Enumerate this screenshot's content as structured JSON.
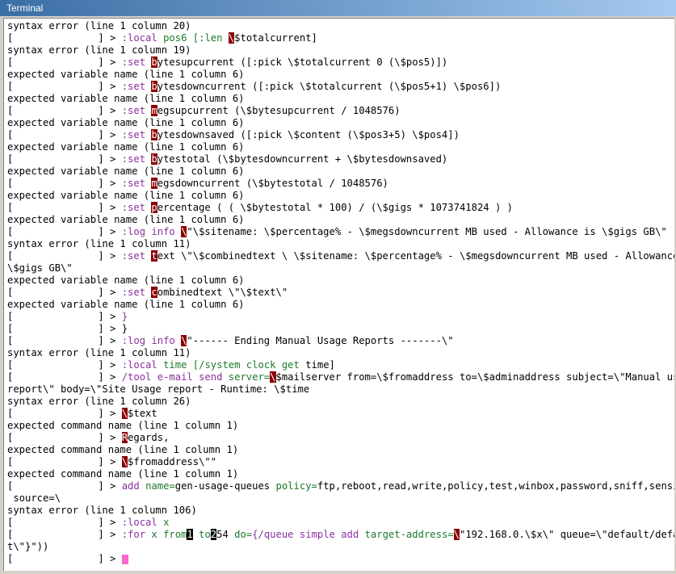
{
  "window": {
    "title": "Terminal"
  },
  "terminal": {
    "prompt_prefix": "[",
    "prompt_suffix": "] > ",
    "lines": [
      {
        "type": "out",
        "text": "syntax error (line 1 column 20)"
      },
      {
        "type": "cmd",
        "parts": [
          {
            "t": ":local ",
            "c": "k"
          },
          {
            "t": "pos6 [:len ",
            "c": "v"
          },
          {
            "t": "\\",
            "c": "cur"
          },
          {
            "t": "$totalcurrent]"
          }
        ]
      },
      {
        "type": "out",
        "text": "syntax error (line 1 column 19)"
      },
      {
        "type": "cmd",
        "parts": [
          {
            "t": ":set ",
            "c": "k"
          },
          {
            "t": "b",
            "c": "cur"
          },
          {
            "t": "ytesupcurrent ([:pick \\$totalcurrent 0 (\\$pos5)])"
          }
        ]
      },
      {
        "type": "out",
        "text": "expected variable name (line 1 column 6)"
      },
      {
        "type": "cmd",
        "parts": [
          {
            "t": ":set ",
            "c": "k"
          },
          {
            "t": "b",
            "c": "cur"
          },
          {
            "t": "ytesdowncurrent ([:pick \\$totalcurrent (\\$pos5+1) \\$pos6])"
          }
        ]
      },
      {
        "type": "out",
        "text": "expected variable name (line 1 column 6)"
      },
      {
        "type": "cmd",
        "parts": [
          {
            "t": ":set ",
            "c": "k"
          },
          {
            "t": "m",
            "c": "cur"
          },
          {
            "t": "egsupcurrent (\\$bytesupcurrent / 1048576)"
          }
        ]
      },
      {
        "type": "out",
        "text": "expected variable name (line 1 column 6)"
      },
      {
        "type": "cmd",
        "parts": [
          {
            "t": ":set ",
            "c": "k"
          },
          {
            "t": "b",
            "c": "cur"
          },
          {
            "t": "ytesdownsaved ([:pick \\$content (\\$pos3+5) \\$pos4])"
          }
        ]
      },
      {
        "type": "out",
        "text": "expected variable name (line 1 column 6)"
      },
      {
        "type": "cmd",
        "parts": [
          {
            "t": ":set ",
            "c": "k"
          },
          {
            "t": "b",
            "c": "cur"
          },
          {
            "t": "ytestotal (\\$bytesdowncurrent + \\$bytesdownsaved)"
          }
        ]
      },
      {
        "type": "out",
        "text": "expected variable name (line 1 column 6)"
      },
      {
        "type": "cmd",
        "parts": [
          {
            "t": ":set ",
            "c": "k"
          },
          {
            "t": "m",
            "c": "cur"
          },
          {
            "t": "egsdowncurrent (\\$bytestotal / 1048576)"
          }
        ]
      },
      {
        "type": "out",
        "text": "expected variable name (line 1 column 6)"
      },
      {
        "type": "cmd",
        "parts": [
          {
            "t": ":set ",
            "c": "k"
          },
          {
            "t": "p",
            "c": "cur"
          },
          {
            "t": "ercentage ( ( \\$bytestotal * 100) / (\\$gigs * 1073741824 ) )"
          }
        ]
      },
      {
        "type": "out",
        "text": "expected variable name (line 1 column 6)"
      },
      {
        "type": "cmd",
        "parts": [
          {
            "t": ":log info ",
            "c": "k"
          },
          {
            "t": "\\",
            "c": "cur"
          },
          {
            "t": "\"\\$sitename: \\$percentage% - \\$megsdowncurrent MB used - Allowance is \\$gigs GB\\\""
          }
        ]
      },
      {
        "type": "out",
        "text": "syntax error (line 1 column 11)"
      },
      {
        "type": "cmd",
        "parts": [
          {
            "t": ":set ",
            "c": "k"
          },
          {
            "t": "t",
            "c": "cur"
          },
          {
            "t": "ext \\\"\\$combinedtext \\ \\$sitename: \\$percentage% - \\$megsdowncurrent MB used - Allowance is"
          }
        ]
      },
      {
        "type": "out",
        "text": "\\$gigs GB\\\""
      },
      {
        "type": "out",
        "text": "expected variable name (line 1 column 6)"
      },
      {
        "type": "cmd",
        "parts": [
          {
            "t": ":set ",
            "c": "k"
          },
          {
            "t": "c",
            "c": "cur"
          },
          {
            "t": "ombinedtext \\\"\\$text\\\""
          }
        ]
      },
      {
        "type": "out",
        "text": "expected variable name (line 1 column 6)"
      },
      {
        "type": "cmd",
        "parts": [
          {
            "t": "}",
            "c": "k"
          }
        ]
      },
      {
        "type": "cmd",
        "parts": [
          {
            "t": "}"
          }
        ]
      },
      {
        "type": "cmd",
        "parts": [
          {
            "t": ":log info ",
            "c": "k"
          },
          {
            "t": "\\",
            "c": "cur"
          },
          {
            "t": "\"------ Ending Manual Usage Reports -------\\\""
          }
        ]
      },
      {
        "type": "out",
        "text": "syntax error (line 1 column 11)"
      },
      {
        "type": "cmd",
        "parts": [
          {
            "t": ":local ",
            "c": "k"
          },
          {
            "t": "time [/system clock get ",
            "c": "v"
          },
          {
            "t": "time]"
          }
        ]
      },
      {
        "type": "cmd",
        "parts": [
          {
            "t": "/tool e-mail send ",
            "c": "k"
          },
          {
            "t": "server=",
            "c": "v"
          },
          {
            "t": "\\",
            "c": "cur"
          },
          {
            "t": "$mailserver from=\\$fromaddress to=\\$adminaddress subject=\\\"Manual usage"
          }
        ]
      },
      {
        "type": "out",
        "text": "report\\\" body=\\\"Site Usage report - Runtime: \\$time"
      },
      {
        "type": "out",
        "text": "syntax error (line 1 column 26)"
      },
      {
        "type": "cmd",
        "parts": [
          {
            "t": "\\",
            "c": "cur"
          },
          {
            "t": "$text"
          }
        ]
      },
      {
        "type": "out",
        "text": "expected command name (line 1 column 1)"
      },
      {
        "type": "cmd",
        "parts": [
          {
            "t": "R",
            "c": "cur"
          },
          {
            "t": "egards,"
          }
        ]
      },
      {
        "type": "out",
        "text": "expected command name (line 1 column 1)"
      },
      {
        "type": "cmd",
        "parts": [
          {
            "t": "\\",
            "c": "cur"
          },
          {
            "t": "$fromaddress\\\"\""
          }
        ]
      },
      {
        "type": "out",
        "text": "expected command name (line 1 column 1)"
      },
      {
        "type": "cmd",
        "parts": [
          {
            "t": "add ",
            "c": "k"
          },
          {
            "t": "name=",
            "c": "v"
          },
          {
            "t": "gen-usage-queues "
          },
          {
            "t": "policy=",
            "c": "v"
          },
          {
            "t": "ftp,reboot,read,write,policy,test,winbox,password,sniff,sensitive"
          }
        ]
      },
      {
        "type": "out",
        "text": " source=\\"
      },
      {
        "type": "out",
        "text": "syntax error (line 1 column 106)"
      },
      {
        "type": "cmd",
        "parts": [
          {
            "t": ":local ",
            "c": "k"
          },
          {
            "t": "x",
            "c": "v"
          }
        ]
      },
      {
        "type": "cmd",
        "parts": [
          {
            "t": ":for ",
            "c": "k"
          },
          {
            "t": "x from",
            "c": "v"
          },
          {
            "t": "1",
            "c": "blk"
          },
          {
            "t": " to",
            "c": "v"
          },
          {
            "t": "2",
            "c": "blk"
          },
          {
            "t": "54 "
          },
          {
            "t": "do=",
            "c": "v"
          },
          {
            "t": "{/queue simple add ",
            "c": "k"
          },
          {
            "t": "target-address=",
            "c": "v"
          },
          {
            "t": "\\",
            "c": "cur"
          },
          {
            "t": "\"192.168.0.\\$x\\\" queue=\\\"default/defaul"
          }
        ]
      },
      {
        "type": "out",
        "text": "t\\\"}\"))"
      },
      {
        "type": "prompt"
      }
    ]
  }
}
